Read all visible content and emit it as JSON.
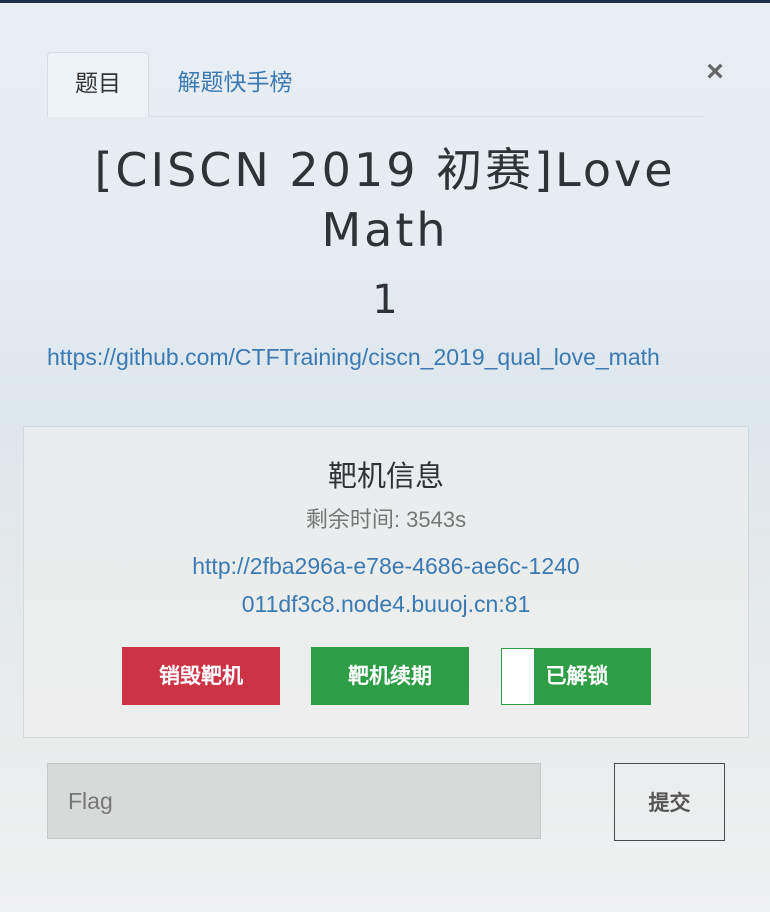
{
  "tabs": [
    {
      "label": "题目",
      "active": true
    },
    {
      "label": "解题快手榜",
      "active": false
    }
  ],
  "close_label": "×",
  "challenge": {
    "title": "[CISCN 2019 初赛]Love Math",
    "points": "1",
    "link": "https://github.com/CTFTraining/ciscn_2019_qual_love_math"
  },
  "target": {
    "heading": "靶机信息",
    "remaining": "剩余时间: 3543s",
    "url": "http://2fba296a-e78e-4686-ae6c-1240011df3c8.node4.buuoj.cn:81",
    "destroy_label": "销毁靶机",
    "renew_label": "靶机续期",
    "unlock_label": "已解锁",
    "unlocked": true
  },
  "flag_form": {
    "placeholder": "Flag",
    "value": "",
    "submit_label": "提交"
  },
  "colors": {
    "link": "#3b7ab3",
    "danger": "#cc3344",
    "success": "#2e9e46"
  }
}
